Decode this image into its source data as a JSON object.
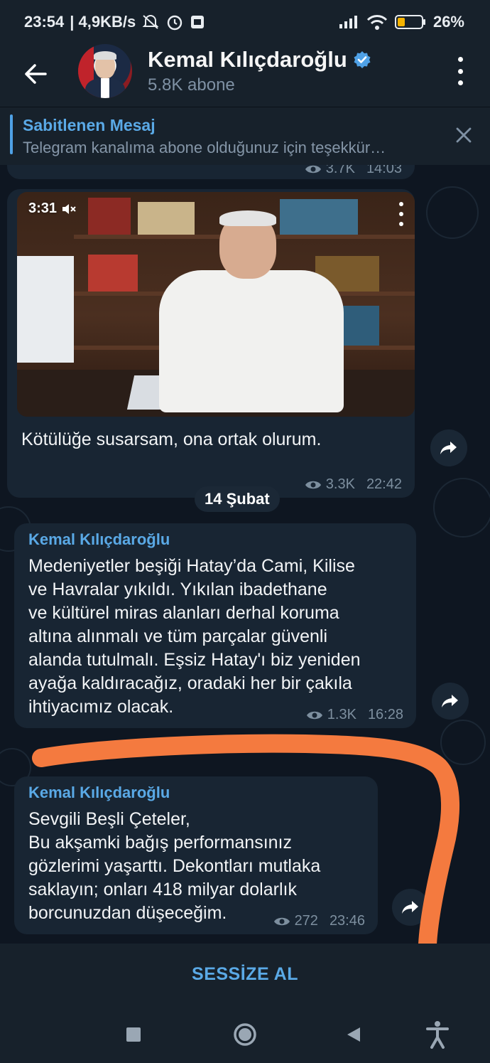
{
  "status_bar": {
    "time": "23:54",
    "network_speed": "| 4,9KB/s",
    "battery": "26%",
    "icons": [
      "alarm-off-icon",
      "alarm-icon",
      "notification-icon",
      "signal-icon",
      "wifi-icon",
      "battery-icon"
    ]
  },
  "header": {
    "channel_name": "Kemal Kılıçdaroğlu",
    "subscribers": "5.8K abone",
    "verified": true
  },
  "pinned": {
    "title": "Sabitlenen Mesaj",
    "text": "Telegram kanalıma abone olduğunuz için teşekkür…"
  },
  "messages": {
    "partial_top": {
      "views": "3.7K",
      "time": "14:03"
    },
    "video_post": {
      "duration": "3:31",
      "caption": "Kötülüğe susarsam, ona ortak olurum.",
      "views": "3.3K",
      "time": "22:42"
    },
    "date_separator": "14 Şubat",
    "hatay_post": {
      "author": "Kemal Kılıçdaroğlu",
      "text": "Medeniyetler beşiği Hatay’da Cami, Kilise\nve Havralar yıkıldı. Yıkılan ibadethane\nve kültürel miras alanları derhal koruma\naltına alınmalı ve tüm parçalar güvenli\nalanda tutulmalı. Eşsiz Hatay'ı biz yeniden\nayağa kaldıracağız, oradaki her bir çakıla\nihtiyacımız olacak.",
      "views": "1.3K",
      "time": "16:28"
    },
    "last_post": {
      "author": "Kemal Kılıçdaroğlu",
      "text": "Sevgili Beşli Çeteler,\nBu akşamki bağış performansınız\ngözlerimi yaşarttı. Dekontları mutlaka\nsaklayın; onları 418 milyar dolarlık\nborcunuzdan düşeceğim.",
      "views": "272",
      "time": "23:46"
    }
  },
  "footer": {
    "mute_button": "SESSİZE AL"
  },
  "colors": {
    "accent": "#5aa9e6",
    "background": "#0e1621",
    "panel": "#17212b",
    "bubble": "#182533",
    "annotation": "#f47a3f"
  }
}
